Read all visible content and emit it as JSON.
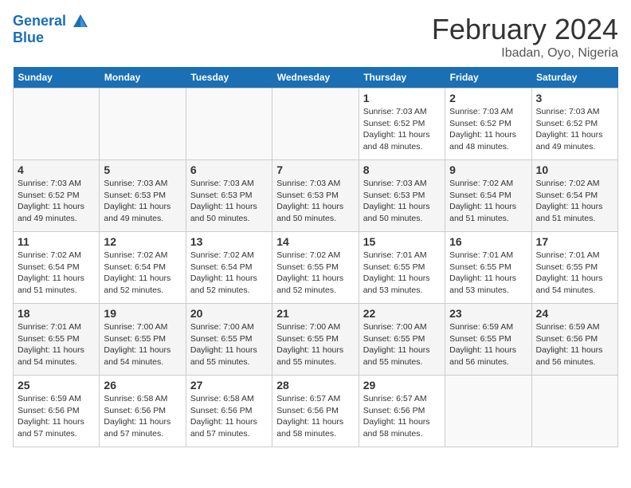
{
  "header": {
    "logo_line1": "General",
    "logo_line2": "Blue",
    "title": "February 2024",
    "subtitle": "Ibadan, Oyo, Nigeria"
  },
  "days_of_week": [
    "Sunday",
    "Monday",
    "Tuesday",
    "Wednesday",
    "Thursday",
    "Friday",
    "Saturday"
  ],
  "weeks": [
    [
      {
        "day": "",
        "info": ""
      },
      {
        "day": "",
        "info": ""
      },
      {
        "day": "",
        "info": ""
      },
      {
        "day": "",
        "info": ""
      },
      {
        "day": "1",
        "info": "Sunrise: 7:03 AM\nSunset: 6:52 PM\nDaylight: 11 hours\nand 48 minutes."
      },
      {
        "day": "2",
        "info": "Sunrise: 7:03 AM\nSunset: 6:52 PM\nDaylight: 11 hours\nand 48 minutes."
      },
      {
        "day": "3",
        "info": "Sunrise: 7:03 AM\nSunset: 6:52 PM\nDaylight: 11 hours\nand 49 minutes."
      }
    ],
    [
      {
        "day": "4",
        "info": "Sunrise: 7:03 AM\nSunset: 6:52 PM\nDaylight: 11 hours\nand 49 minutes."
      },
      {
        "day": "5",
        "info": "Sunrise: 7:03 AM\nSunset: 6:53 PM\nDaylight: 11 hours\nand 49 minutes."
      },
      {
        "day": "6",
        "info": "Sunrise: 7:03 AM\nSunset: 6:53 PM\nDaylight: 11 hours\nand 50 minutes."
      },
      {
        "day": "7",
        "info": "Sunrise: 7:03 AM\nSunset: 6:53 PM\nDaylight: 11 hours\nand 50 minutes."
      },
      {
        "day": "8",
        "info": "Sunrise: 7:03 AM\nSunset: 6:53 PM\nDaylight: 11 hours\nand 50 minutes."
      },
      {
        "day": "9",
        "info": "Sunrise: 7:02 AM\nSunset: 6:54 PM\nDaylight: 11 hours\nand 51 minutes."
      },
      {
        "day": "10",
        "info": "Sunrise: 7:02 AM\nSunset: 6:54 PM\nDaylight: 11 hours\nand 51 minutes."
      }
    ],
    [
      {
        "day": "11",
        "info": "Sunrise: 7:02 AM\nSunset: 6:54 PM\nDaylight: 11 hours\nand 51 minutes."
      },
      {
        "day": "12",
        "info": "Sunrise: 7:02 AM\nSunset: 6:54 PM\nDaylight: 11 hours\nand 52 minutes."
      },
      {
        "day": "13",
        "info": "Sunrise: 7:02 AM\nSunset: 6:54 PM\nDaylight: 11 hours\nand 52 minutes."
      },
      {
        "day": "14",
        "info": "Sunrise: 7:02 AM\nSunset: 6:55 PM\nDaylight: 11 hours\nand 52 minutes."
      },
      {
        "day": "15",
        "info": "Sunrise: 7:01 AM\nSunset: 6:55 PM\nDaylight: 11 hours\nand 53 minutes."
      },
      {
        "day": "16",
        "info": "Sunrise: 7:01 AM\nSunset: 6:55 PM\nDaylight: 11 hours\nand 53 minutes."
      },
      {
        "day": "17",
        "info": "Sunrise: 7:01 AM\nSunset: 6:55 PM\nDaylight: 11 hours\nand 54 minutes."
      }
    ],
    [
      {
        "day": "18",
        "info": "Sunrise: 7:01 AM\nSunset: 6:55 PM\nDaylight: 11 hours\nand 54 minutes."
      },
      {
        "day": "19",
        "info": "Sunrise: 7:00 AM\nSunset: 6:55 PM\nDaylight: 11 hours\nand 54 minutes."
      },
      {
        "day": "20",
        "info": "Sunrise: 7:00 AM\nSunset: 6:55 PM\nDaylight: 11 hours\nand 55 minutes."
      },
      {
        "day": "21",
        "info": "Sunrise: 7:00 AM\nSunset: 6:55 PM\nDaylight: 11 hours\nand 55 minutes."
      },
      {
        "day": "22",
        "info": "Sunrise: 7:00 AM\nSunset: 6:55 PM\nDaylight: 11 hours\nand 55 minutes."
      },
      {
        "day": "23",
        "info": "Sunrise: 6:59 AM\nSunset: 6:55 PM\nDaylight: 11 hours\nand 56 minutes."
      },
      {
        "day": "24",
        "info": "Sunrise: 6:59 AM\nSunset: 6:56 PM\nDaylight: 11 hours\nand 56 minutes."
      }
    ],
    [
      {
        "day": "25",
        "info": "Sunrise: 6:59 AM\nSunset: 6:56 PM\nDaylight: 11 hours\nand 57 minutes."
      },
      {
        "day": "26",
        "info": "Sunrise: 6:58 AM\nSunset: 6:56 PM\nDaylight: 11 hours\nand 57 minutes."
      },
      {
        "day": "27",
        "info": "Sunrise: 6:58 AM\nSunset: 6:56 PM\nDaylight: 11 hours\nand 57 minutes."
      },
      {
        "day": "28",
        "info": "Sunrise: 6:57 AM\nSunset: 6:56 PM\nDaylight: 11 hours\nand 58 minutes."
      },
      {
        "day": "29",
        "info": "Sunrise: 6:57 AM\nSunset: 6:56 PM\nDaylight: 11 hours\nand 58 minutes."
      },
      {
        "day": "",
        "info": ""
      },
      {
        "day": "",
        "info": ""
      }
    ]
  ]
}
